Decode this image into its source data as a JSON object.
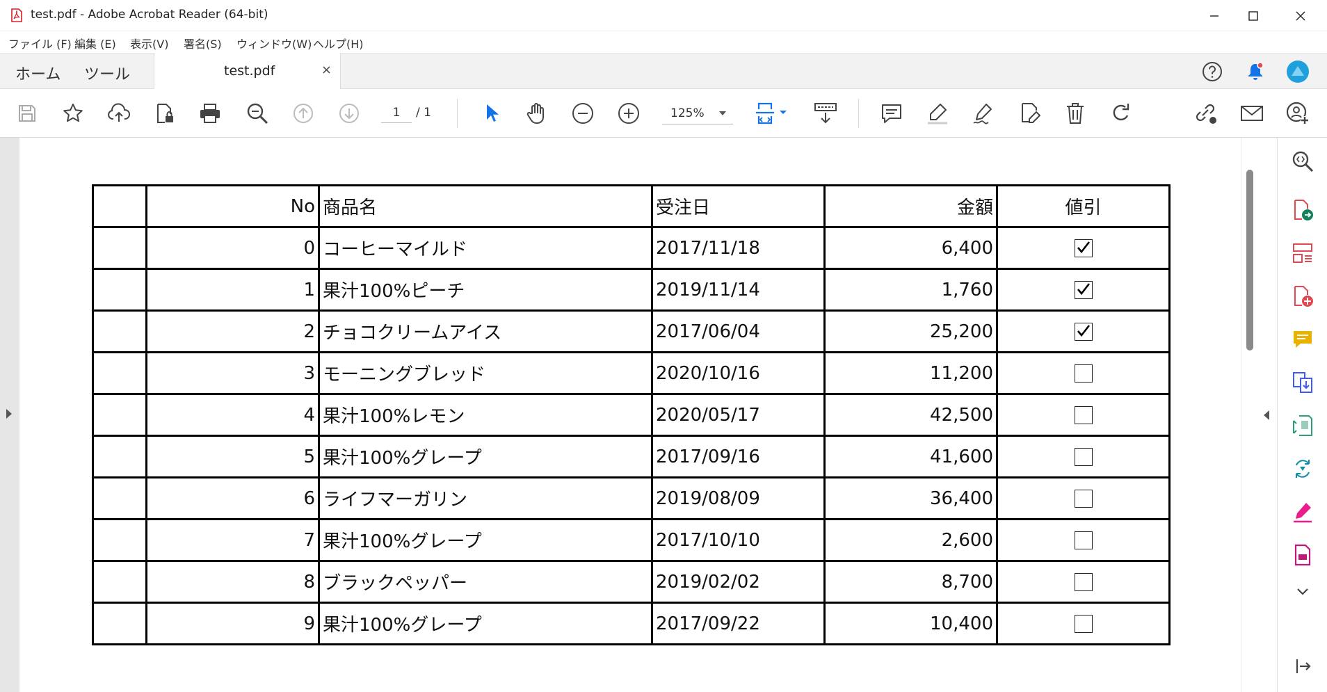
{
  "window": {
    "title": "test.pdf - Adobe Acrobat Reader (64-bit)",
    "controls": [
      "minimize",
      "maximize",
      "close"
    ]
  },
  "menu": [
    "ファイル (F)",
    "編集 (E)",
    "表示(V)",
    "署名(S)",
    "ウィンドウ(W)",
    "ヘルプ(H)"
  ],
  "tabs": {
    "home": "ホーム",
    "tools": "ツール",
    "document": "test.pdf",
    "close": "×"
  },
  "toolbar": {
    "page_current": "1",
    "page_total": "/ 1",
    "zoom": "125%",
    "accent_color": "#1473e6"
  },
  "table": {
    "headers": [
      "",
      "No",
      "商品名",
      "受注日",
      "金額",
      "値引"
    ],
    "rows": [
      {
        "no": "0",
        "name": "コーヒーマイルド",
        "date": "2017/11/18",
        "amount": "6,400",
        "discount": true
      },
      {
        "no": "1",
        "name": "果汁100%ピーチ",
        "date": "2019/11/14",
        "amount": "1,760",
        "discount": true
      },
      {
        "no": "2",
        "name": "チョコクリームアイス",
        "date": "2017/06/04",
        "amount": "25,200",
        "discount": true
      },
      {
        "no": "3",
        "name": "モーニングブレッド",
        "date": "2020/10/16",
        "amount": "11,200",
        "discount": false
      },
      {
        "no": "4",
        "name": "果汁100%レモン",
        "date": "2020/05/17",
        "amount": "42,500",
        "discount": false
      },
      {
        "no": "5",
        "name": "果汁100%グレープ",
        "date": "2017/09/16",
        "amount": "41,600",
        "discount": false
      },
      {
        "no": "6",
        "name": "ライフマーガリン",
        "date": "2019/08/09",
        "amount": "36,400",
        "discount": false
      },
      {
        "no": "7",
        "name": "果汁100%グレープ",
        "date": "2017/10/10",
        "amount": "2,600",
        "discount": false
      },
      {
        "no": "8",
        "name": "ブラックペッパー",
        "date": "2019/02/02",
        "amount": "8,700",
        "discount": false
      },
      {
        "no": "9",
        "name": "果汁100%グレープ",
        "date": "2017/09/22",
        "amount": "10,400",
        "discount": false
      }
    ]
  }
}
